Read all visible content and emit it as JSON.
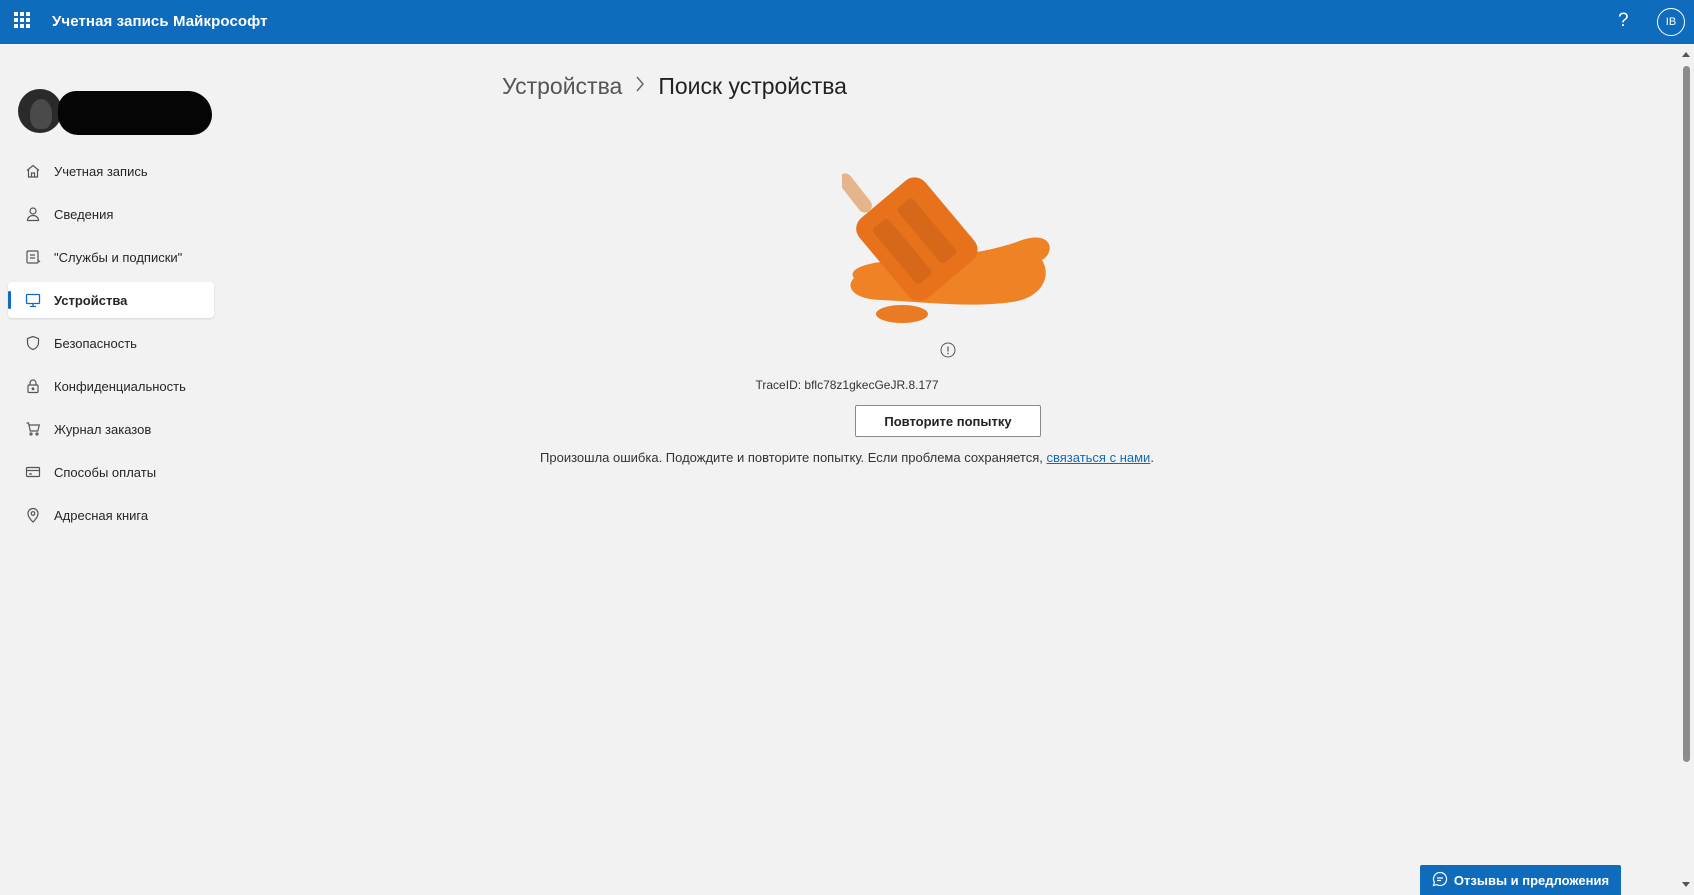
{
  "header": {
    "app_title": "Учетная запись Майкрософт",
    "help_label": "?",
    "user_initials": "IB",
    "accent_color": "#0f6cbd"
  },
  "sidebar": {
    "items": [
      {
        "label": "Учетная запись",
        "icon": "home-icon",
        "active": false
      },
      {
        "label": "Сведения",
        "icon": "person-icon",
        "active": false
      },
      {
        "label": "\"Службы и подписки\"",
        "icon": "subscriptions-icon",
        "active": false
      },
      {
        "label": "Устройства",
        "icon": "monitor-icon",
        "active": true
      },
      {
        "label": "Безопасность",
        "icon": "shield-icon",
        "active": false
      },
      {
        "label": "Конфиденциальность",
        "icon": "lock-icon",
        "active": false
      },
      {
        "label": "Журнал заказов",
        "icon": "cart-icon",
        "active": false
      },
      {
        "label": "Способы оплаты",
        "icon": "credit-card-icon",
        "active": false
      },
      {
        "label": "Адресная книга",
        "icon": "location-pin-icon",
        "active": false
      }
    ]
  },
  "breadcrumb": {
    "parent": "Устройства",
    "current": "Поиск устройства"
  },
  "error": {
    "trace_label": "TraceID:",
    "trace_id": "bflc78z1gkecGeJR.8.177",
    "retry_label": "Повторите попытку",
    "message": "Произошла ошибка. Подождите и повторите попытку. Если проблема сохраняется,",
    "link_text": "связаться с нами",
    "message_end": "."
  },
  "feedback": {
    "label": "Отзывы и предложения"
  }
}
